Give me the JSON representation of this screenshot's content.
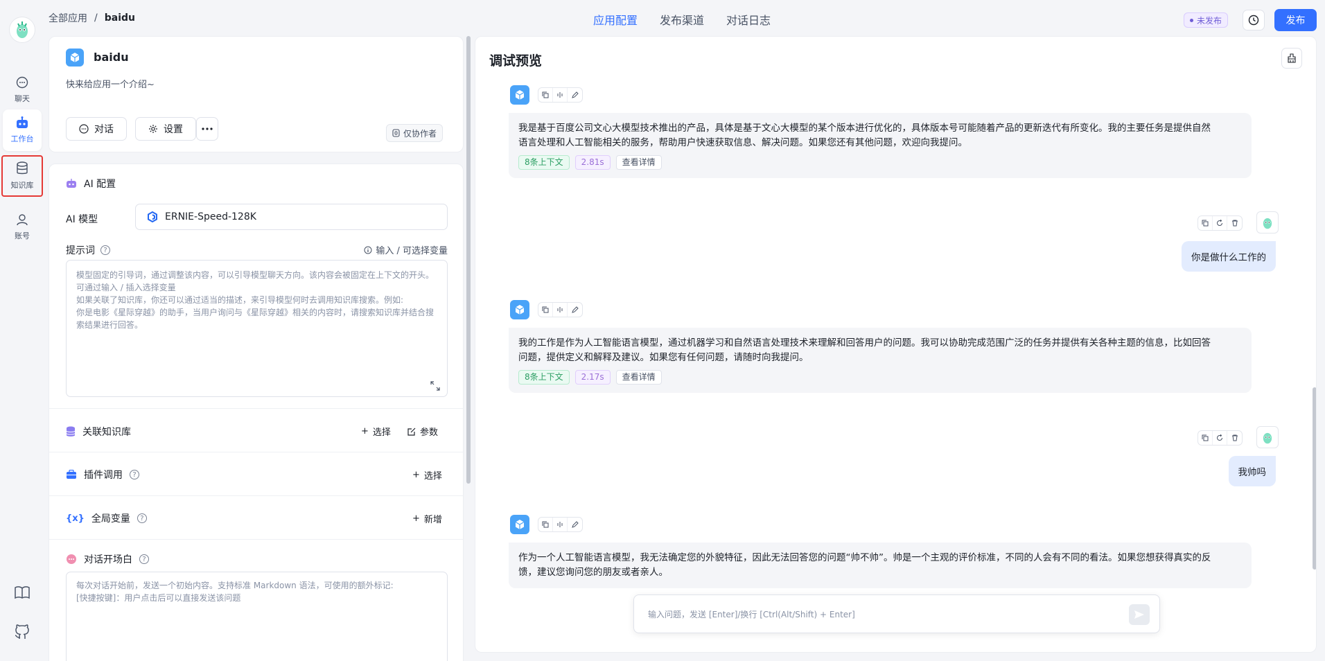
{
  "rail": {
    "items": [
      {
        "label": "聊天",
        "icon": "chat-icon"
      },
      {
        "label": "工作台",
        "icon": "robot-icon"
      },
      {
        "label": "知识库",
        "icon": "database-icon"
      },
      {
        "label": "账号",
        "icon": "user-icon"
      }
    ],
    "bottom_icons": [
      "book-icon",
      "github-icon"
    ]
  },
  "breadcrumb": {
    "root": "全部应用",
    "separator": "/",
    "current": "baidu"
  },
  "top_tabs": [
    "应用配置",
    "发布渠道",
    "对话日志"
  ],
  "header": {
    "status": "未发布",
    "publish": "发布"
  },
  "app": {
    "name": "baidu",
    "intro": "快来给应用一个介绍~",
    "chat_btn": "对话",
    "settings_btn": "设置",
    "collab": "仅协作者"
  },
  "config": {
    "ai_title": "AI 配置",
    "model_label": "AI 模型",
    "model_value": "ERNIE-Speed-128K",
    "prompt_label": "提示词",
    "prompt_var": "输入 / 可选择变量",
    "prompt_placeholder": [
      "模型固定的引导词，通过调整该内容，可以引导模型聊天方向。该内容会被固定在上下文的开头。",
      "可通过输入 / 插入选择变量",
      "如果关联了知识库，你还可以通过适当的描述，来引导模型何时去调用知识库搜索。例如:",
      "你是电影《星际穿越》的助手，当用户询问与《星际穿越》相关的内容时，请搜索知识库并结合搜",
      "索结果进行回答。"
    ],
    "kb_title": "关联知识库",
    "kb_select": "选择",
    "kb_params": "参数",
    "plugin_title": "插件调用",
    "plugin_select": "选择",
    "vars_title": "全局变量",
    "vars_add": "新增",
    "welcome_title": "对话开场白",
    "welcome_placeholder": [
      "每次对话开始前，发送一个初始内容。支持标准 Markdown 语法，可使用的额外标记:",
      "[快捷按键]：用户点击后可以直接发送该问题"
    ]
  },
  "preview": {
    "title": "调试预览",
    "messages": [
      {
        "role": "bot",
        "lines": [
          "我是基于百度公司文心大模型技术推出的产品，具体是基于文心大模型的某个版本进行优化的，具体版本号可能随着产品的更新迭代有所变化。我的主要任务是提供自然",
          "语言处理和人工智能相关的服务，帮助用户快速获取信息、解决问题。如果您还有其他问题，欢迎向我提问。"
        ],
        "context": "8条上下文",
        "time": "2.81s",
        "detail": "查看详情"
      },
      {
        "role": "user",
        "text": "你是做什么工作的"
      },
      {
        "role": "bot",
        "lines": [
          "我的工作是作为人工智能语言模型，通过机器学习和自然语言处理技术来理解和回答用户的问题。我可以协助完成范围广泛的任务并提供有关各种主题的信息，比如回答",
          "问题，提供定义和解释及建议。如果您有任何问题，请随时向我提问。"
        ],
        "context": "8条上下文",
        "time": "2.17s",
        "detail": "查看详情"
      },
      {
        "role": "user",
        "text": "我帅吗"
      },
      {
        "role": "bot",
        "lines": [
          "作为一个人工智能语言模型，我无法确定您的外貌特征，因此无法回答您的问题“帅不帅”。帅是一个主观的评价标准，不同的人会有不同的看法。如果您想获得真实的反",
          "馈，建议您询问您的朋友或者亲人。"
        ]
      }
    ],
    "input_placeholder": "输入问题，发送 [Enter]/换行 [Ctrl(Alt/Shift) + Enter]"
  },
  "colors": {
    "accent": "#3370ff",
    "highlight": "#e53935",
    "bot_icon": "#4aa3f8"
  }
}
